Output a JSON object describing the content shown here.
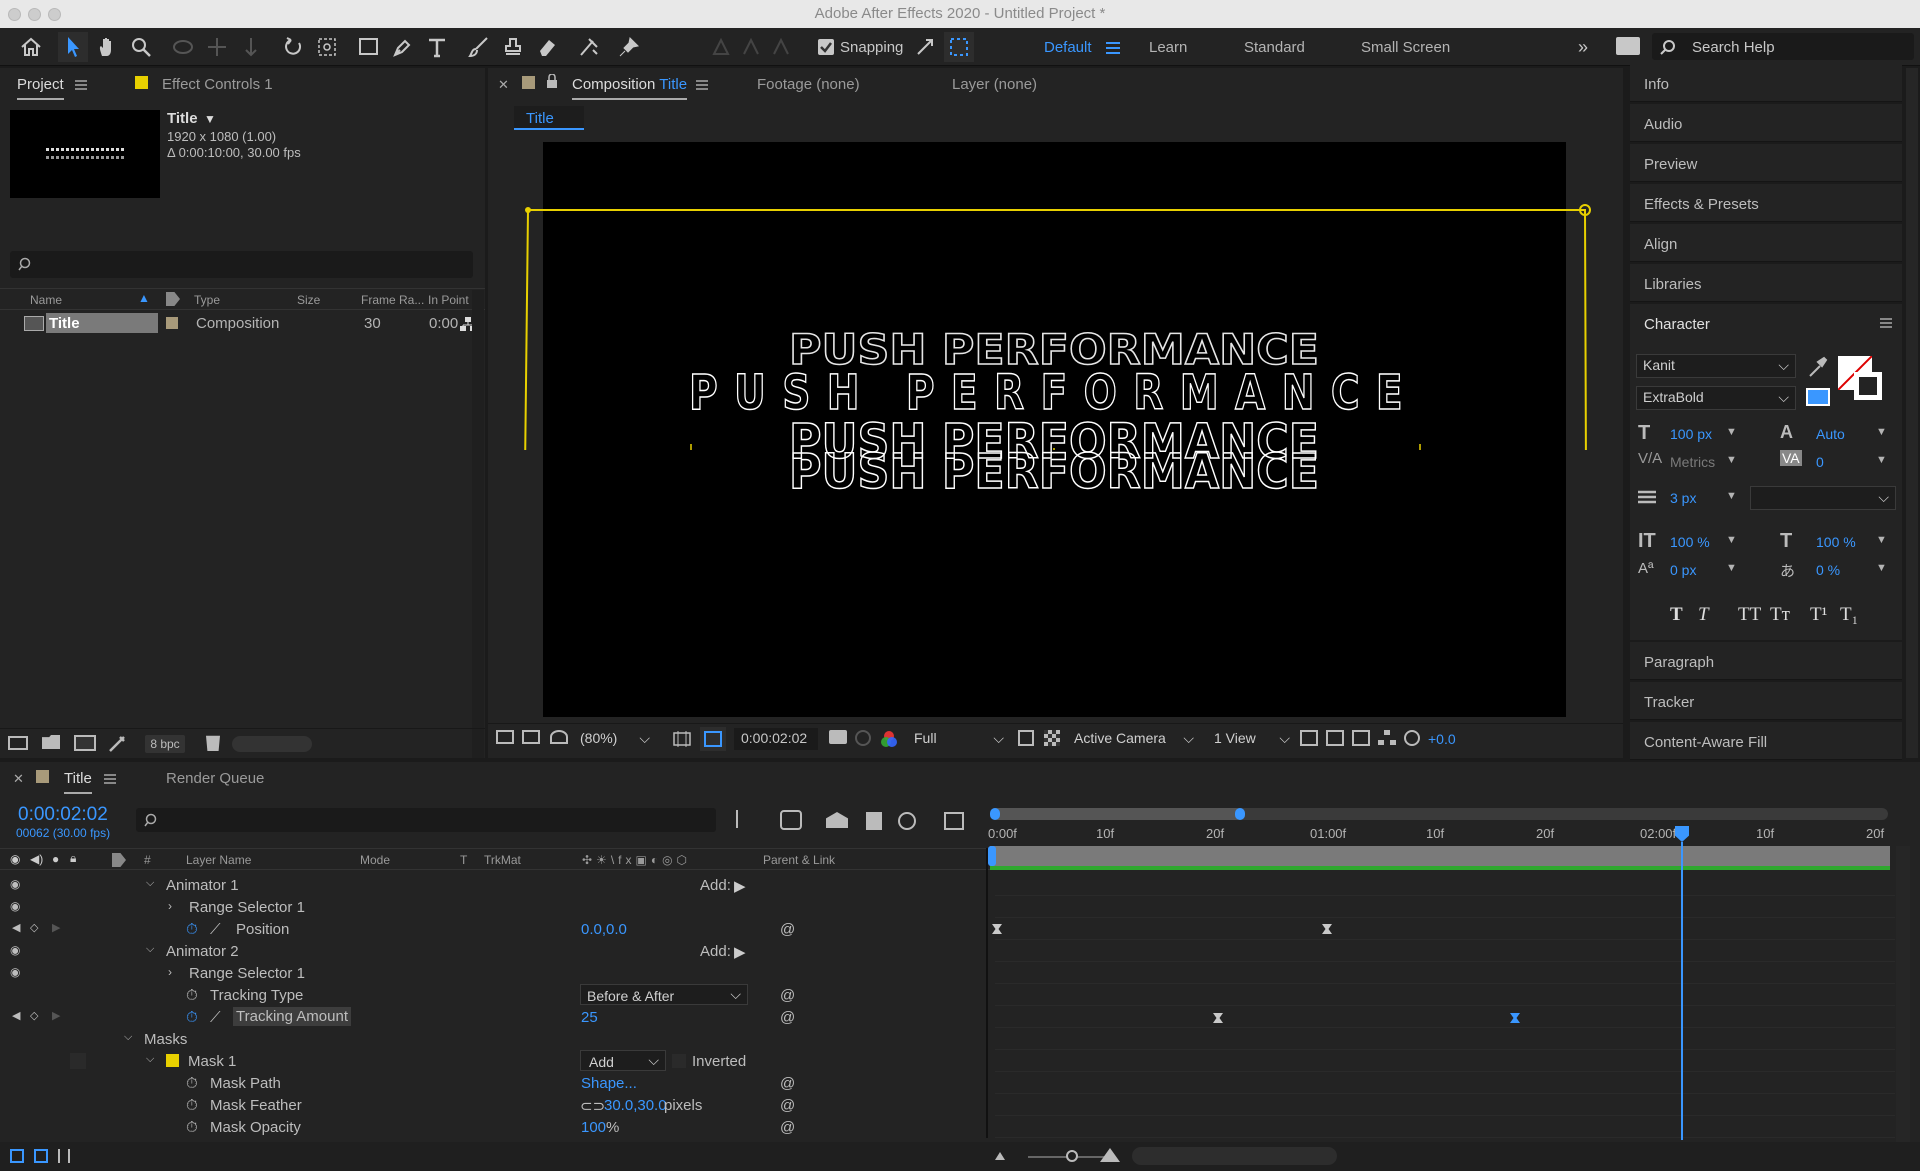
{
  "window": {
    "title": "Adobe After Effects 2020 - Untitled Project *"
  },
  "toolbar": {
    "snapping": "Snapping",
    "workspaces": [
      "Default",
      "Learn",
      "Standard",
      "Small Screen"
    ],
    "search_help": "Search Help"
  },
  "project_panel": {
    "tab_project": "Project",
    "tab_effect_controls": "Effect Controls 1",
    "item_title": "Title",
    "item_dims": "1920 x 1080 (1.00)",
    "item_duration": "Δ 0:00:10:00, 30.00 fps",
    "columns": [
      "Name",
      "Type",
      "Size",
      "Frame Ra...",
      "In Point"
    ],
    "row": {
      "name": "Title",
      "type": "Composition",
      "frame_rate": "30",
      "in_point": "0:00"
    },
    "bpc": "8 bpc"
  },
  "comp_panel": {
    "tab_prefix": "Composition",
    "tab_name": "Title",
    "footage_tab": "Footage (none)",
    "layer_tab": "Layer (none)",
    "breadcrumb": "Title",
    "text_lines": [
      "PUSH PERFORMANCE",
      "PUSH PERFORMANCE",
      "PUSH PERFORMANCE",
      "PUSH PERFORMANCE"
    ],
    "zoom": "(80%)",
    "timecode": "0:00:02:02",
    "resolution": "Full",
    "camera": "Active Camera",
    "views": "1 View",
    "exposure": "+0.0"
  },
  "right_panels": [
    "Info",
    "Audio",
    "Preview",
    "Effects & Presets",
    "Align",
    "Libraries"
  ],
  "character": {
    "title": "Character",
    "font": "Kanit",
    "style": "ExtraBold",
    "size": "100 px",
    "leading": "Auto",
    "kerning": "Metrics",
    "tracking": "0",
    "stroke": "3 px",
    "vscale": "100 %",
    "hscale": "100 %",
    "baseline": "0 px",
    "tsume": "0 %",
    "style_buttons": [
      "T",
      "T",
      "TT",
      "Tт",
      "T¹",
      "T₁"
    ]
  },
  "right_panels_bottom": [
    "Paragraph",
    "Tracker",
    "Content-Aware Fill"
  ],
  "timeline": {
    "tab": "Title",
    "render_queue": "Render Queue",
    "timecode": "0:00:02:02",
    "frames": "00062 (30.00 fps)",
    "columns": {
      "layer_name": "Layer Name",
      "mode": "Mode",
      "t": "T",
      "trkmat": "TrkMat",
      "parent": "Parent & Link",
      "num": "#"
    },
    "ruler": [
      "0:00f",
      "10f",
      "20f",
      "01:00f",
      "10f",
      "20f",
      "02:00f",
      "10f",
      "20f"
    ],
    "rows": [
      {
        "label": "Animator 1",
        "add": "Add:"
      },
      {
        "label": "Range Selector 1"
      },
      {
        "label": "Position",
        "value": "0.0,0.0"
      },
      {
        "label": "Animator 2",
        "add": "Add:"
      },
      {
        "label": "Range Selector 1"
      },
      {
        "label": "Tracking Type",
        "value": "Before & After"
      },
      {
        "label": "Tracking Amount",
        "value": "25"
      },
      {
        "label": "Masks"
      },
      {
        "label": "Mask 1",
        "value": "Add",
        "extra": "Inverted"
      },
      {
        "label": "Mask Path",
        "value": "Shape..."
      },
      {
        "label": "Mask Feather",
        "value": "30.0,30.0",
        "unit": " pixels"
      },
      {
        "label": "Mask Opacity",
        "value": "100",
        "unit": "%"
      }
    ]
  },
  "colors": {
    "accent": "#3a97ff",
    "guide": "#e8d000",
    "panel": "#232323",
    "bg": "#1b1b1b"
  }
}
